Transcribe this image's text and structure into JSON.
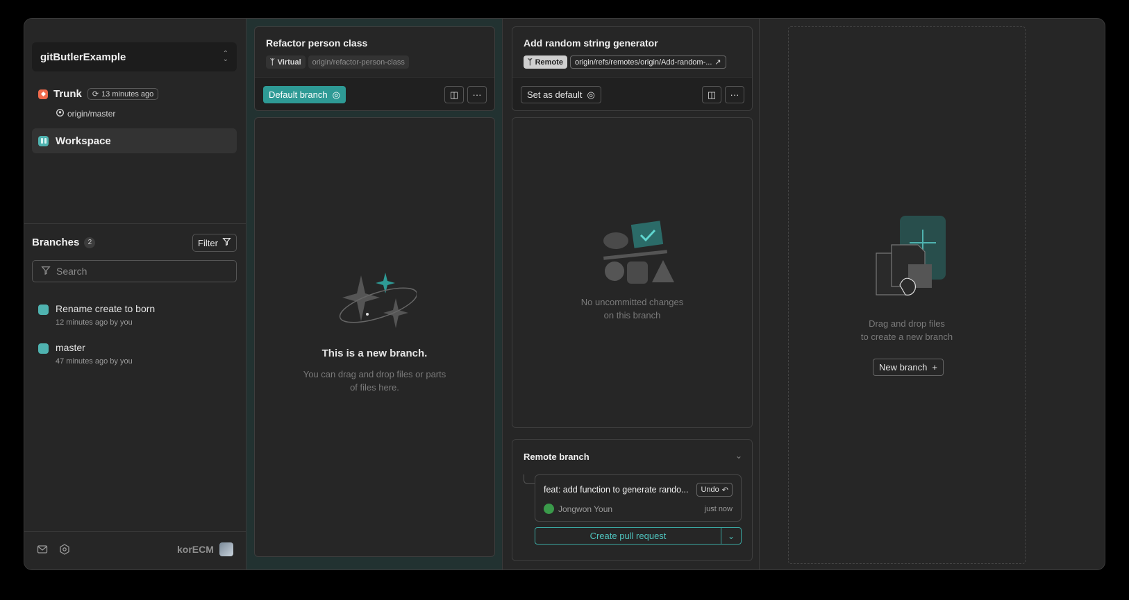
{
  "sidebar": {
    "project": "gitButlerExample",
    "trunk": {
      "label": "Trunk",
      "fetched": "13 minutes ago",
      "remote": "origin/master"
    },
    "workspace": "Workspace",
    "branches": {
      "title": "Branches",
      "count": "2",
      "filter": "Filter",
      "search_placeholder": "Search",
      "items": [
        {
          "name": "Rename create to born",
          "meta": "12 minutes ago by you"
        },
        {
          "name": "master",
          "meta": "47 minutes ago by you"
        }
      ]
    },
    "user": "korECM"
  },
  "lane1": {
    "title": "Refactor person class",
    "tag": "Virtual",
    "ref": "origin/refactor-person-class",
    "default_button": "Default branch",
    "empty_title": "This is a new branch.",
    "empty_sub_1": "You can drag and drop files or parts",
    "empty_sub_2": "of files here."
  },
  "lane2": {
    "title": "Add random string generator",
    "tag": "Remote",
    "ref": "origin/refs/remotes/origin/Add-random-...",
    "set_default": "Set as default",
    "empty_1": "No uncommitted changes",
    "empty_2": "on this branch",
    "remote_section": {
      "title": "Remote branch",
      "commit_title": "feat: add function to generate rando...",
      "undo": "Undo",
      "author": "Jongwon Youn",
      "time": "just now",
      "pr_button": "Create pull request"
    }
  },
  "dropzone": {
    "line1": "Drag and drop files",
    "line2": "to create a new branch",
    "new_branch": "New branch"
  },
  "colors": {
    "accent": "#2e9a95",
    "trunk": "#ef6a4c",
    "branch": "#4fb3b0"
  }
}
